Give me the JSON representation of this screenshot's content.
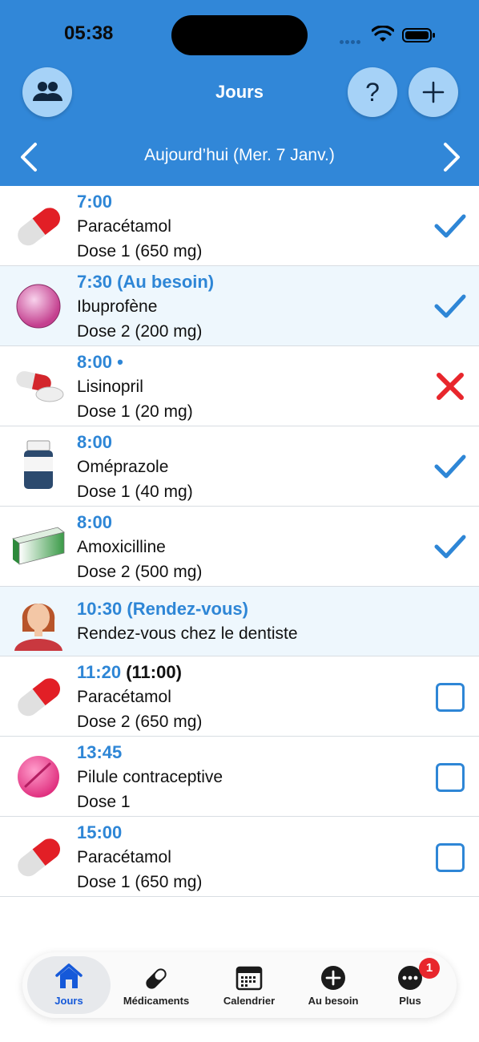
{
  "status_bar": {
    "time": "05:38"
  },
  "header": {
    "title": "Jours",
    "date_label": "Aujourd’hui (Mer. 7 Janv.)",
    "buttons": {
      "profiles_icon": "people-icon",
      "help_label": "?",
      "add_icon": "plus-icon"
    }
  },
  "entries": [
    {
      "time": "7:00",
      "extra": "",
      "name": "Paracétamol",
      "dose": "Dose 1 (650 mg)",
      "icon": "capsule-red-icon",
      "status": "taken",
      "shaded": false
    },
    {
      "time": "7:30 (Au besoin)",
      "extra": "",
      "name": "Ibuprofène",
      "dose": "Dose 2 (200 mg)",
      "icon": "pink-pearl-icon",
      "status": "taken",
      "shaded": true
    },
    {
      "time": "8:00 •",
      "extra": "",
      "name": "Lisinopril",
      "dose": "Dose 1 (20 mg)",
      "icon": "pill-and-tablet-icon",
      "status": "skipped",
      "shaded": false
    },
    {
      "time": "8:00",
      "extra": "",
      "name": "Oméprazole",
      "dose": "Dose 1 (40 mg)",
      "icon": "pill-bottle-icon",
      "status": "taken",
      "shaded": false
    },
    {
      "time": "8:00",
      "extra": "",
      "name": "Amoxicilline",
      "dose": "Dose 2 (500 mg)",
      "icon": "medicine-box-icon",
      "status": "taken",
      "shaded": false
    },
    {
      "time": "10:30 (Rendez-vous)",
      "extra": "",
      "name": "Rendez-vous chez le dentiste",
      "dose": "",
      "icon": "woman-avatar-icon",
      "status": "none",
      "shaded": true
    },
    {
      "time": "11:20",
      "extra": "(11:00)",
      "name": "Paracétamol",
      "dose": "Dose 2 (650 mg)",
      "icon": "capsule-red-icon",
      "status": "pending",
      "shaded": false
    },
    {
      "time": "13:45",
      "extra": "",
      "name": "Pilule contraceptive",
      "dose": "Dose 1",
      "icon": "pink-tablet-icon",
      "status": "pending",
      "shaded": false
    },
    {
      "time": "15:00",
      "extra": "",
      "name": "Paracétamol",
      "dose": "Dose 1 (650 mg)",
      "icon": "capsule-red-icon",
      "status": "pending",
      "shaded": false
    }
  ],
  "tabbar": {
    "tabs": [
      {
        "label": "Jours",
        "icon": "house-icon",
        "active": true
      },
      {
        "label": "Médicaments",
        "icon": "capsule-icon",
        "active": false
      },
      {
        "label": "Calendrier",
        "icon": "calendar-icon",
        "active": false
      },
      {
        "label": "Au besoin",
        "icon": "plus-circle-icon",
        "active": false
      },
      {
        "label": "Plus",
        "icon": "more-icon",
        "active": false,
        "badge": "1"
      }
    ]
  },
  "colors": {
    "header": "#3187d8",
    "accent": "#2e86d6",
    "skip": "#e8262c",
    "active_tab": "#1559d9"
  }
}
